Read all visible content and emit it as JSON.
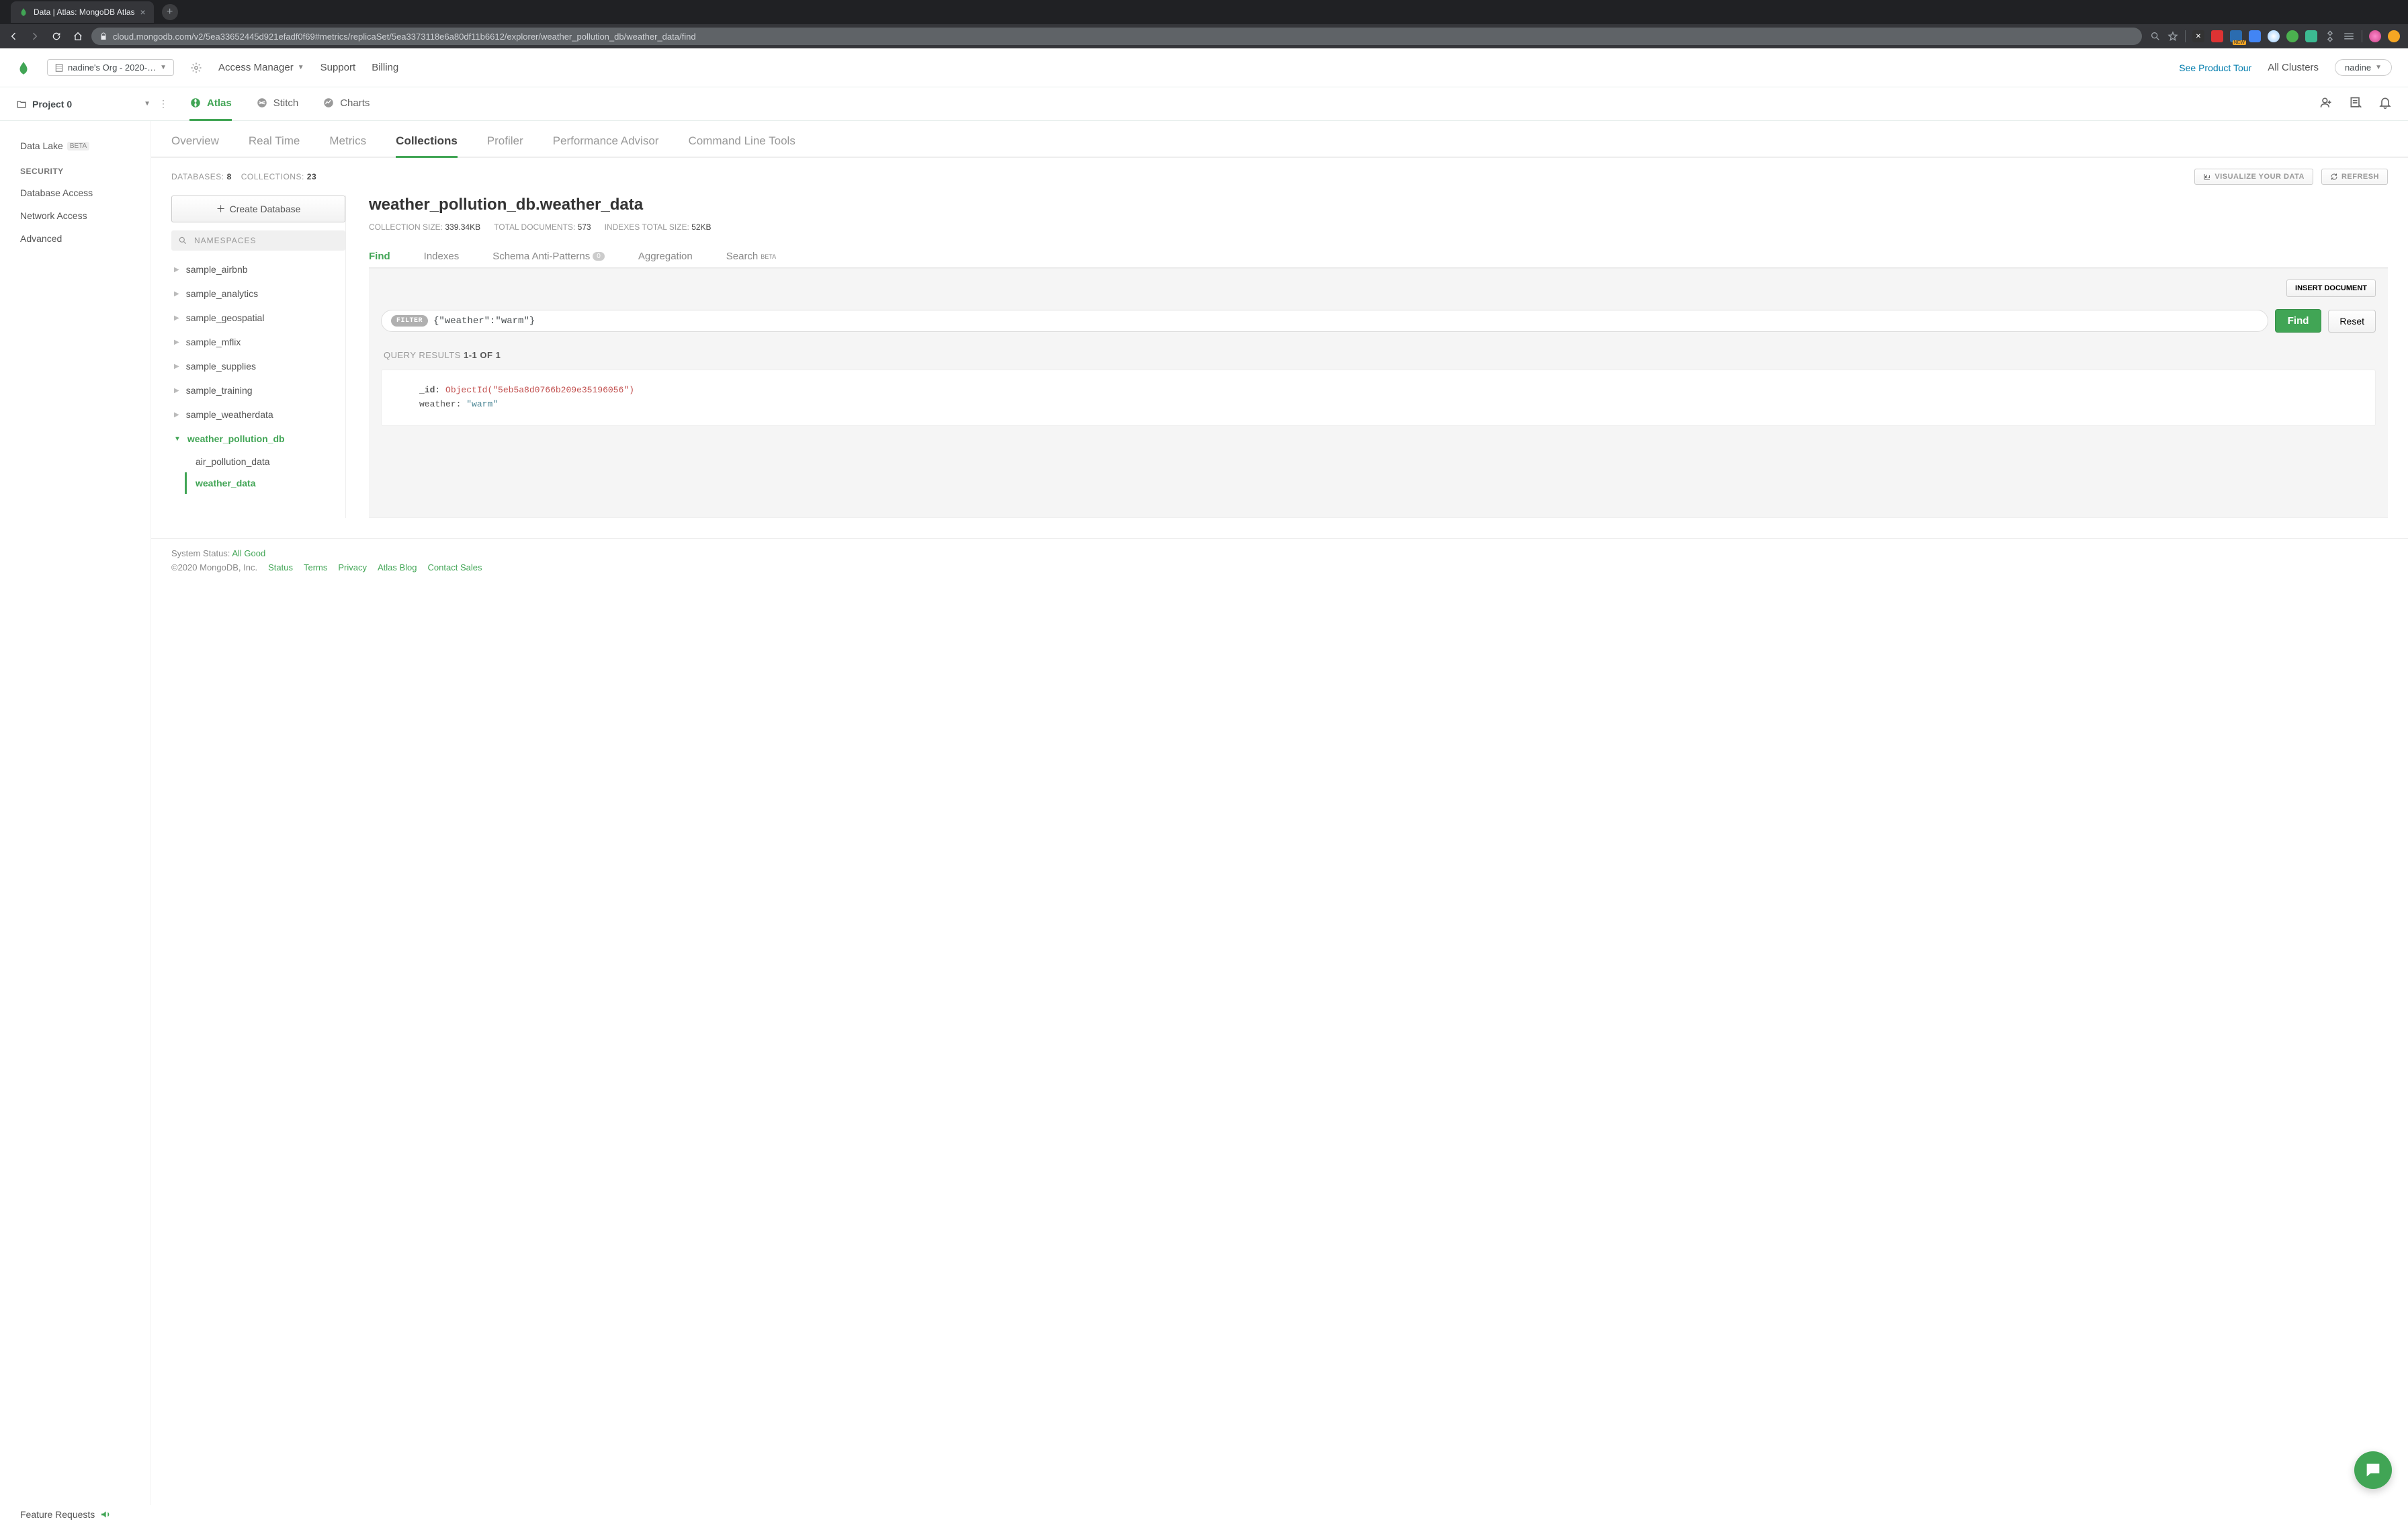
{
  "browser": {
    "tab_title": "Data | Atlas: MongoDB Atlas",
    "url": "cloud.mongodb.com/v2/5ea33652445d921efadf0f69#metrics/replicaSet/5ea3373118e6a80df11b6612/explorer/weather_pollution_db/weather_data/find"
  },
  "topnav": {
    "org": "nadine's Org - 2020-…",
    "access_manager": "Access Manager",
    "support": "Support",
    "billing": "Billing",
    "product_tour": "See Product Tour",
    "all_clusters": "All Clusters",
    "user": "nadine"
  },
  "project": {
    "name": "Project 0",
    "tabs": {
      "atlas": "Atlas",
      "stitch": "Stitch",
      "charts": "Charts"
    }
  },
  "left_sidebar": {
    "data_lake": "Data Lake",
    "data_lake_badge": "BETA",
    "security_heading": "SECURITY",
    "database_access": "Database Access",
    "network_access": "Network Access",
    "advanced": "Advanced"
  },
  "subtabs": {
    "overview": "Overview",
    "real_time": "Real Time",
    "metrics": "Metrics",
    "collections": "Collections",
    "profiler": "Profiler",
    "perf_advisor": "Performance Advisor",
    "cli_tools": "Command Line Tools"
  },
  "stats": {
    "databases_label": "DATABASES:",
    "databases_count": "8",
    "collections_label": "COLLECTIONS:",
    "collections_count": "23",
    "visualize": "VISUALIZE YOUR DATA",
    "refresh": "REFRESH"
  },
  "db_sidebar": {
    "create": "Create Database",
    "namespaces": "NAMESPACES",
    "namespaces_placeholder": "NAMESPACES",
    "databases": [
      "sample_airbnb",
      "sample_analytics",
      "sample_geospatial",
      "sample_mflix",
      "sample_supplies",
      "sample_training",
      "sample_weatherdata"
    ],
    "active_db": "weather_pollution_db",
    "collections": [
      "air_pollution_data"
    ],
    "active_collection": "weather_data"
  },
  "collection": {
    "title": "weather_pollution_db.weather_data",
    "size_label": "COLLECTION SIZE:",
    "size": "339.34KB",
    "docs_label": "TOTAL DOCUMENTS:",
    "docs": "573",
    "idx_label": "INDEXES TOTAL SIZE:",
    "idx": "52KB",
    "tabs": {
      "find": "Find",
      "indexes": "Indexes",
      "schema": "Schema Anti-Patterns",
      "schema_count": "0",
      "aggregation": "Aggregation",
      "search": "Search",
      "search_beta": "BETA"
    },
    "insert": "INSERT DOCUMENT",
    "filter_badge": "FILTER",
    "filter_value": "{\"weather\":\"warm\"}",
    "find_btn": "Find",
    "reset_btn": "Reset",
    "results_label": "QUERY RESULTS",
    "results_range": "1-1",
    "results_of": "OF",
    "results_total": "1",
    "doc": {
      "id_key": "_id",
      "id_fn": "ObjectId(",
      "id_val": "\"5eb5a8d0766b209e35196056\"",
      "id_close": ")",
      "weather_key": "weather",
      "weather_val": "\"warm\""
    }
  },
  "footer": {
    "status_label": "System Status:",
    "status_val": "All Good",
    "copyright": "©2020 MongoDB, Inc.",
    "links": [
      "Status",
      "Terms",
      "Privacy",
      "Atlas Blog",
      "Contact Sales"
    ],
    "feature_requests": "Feature Requests"
  }
}
